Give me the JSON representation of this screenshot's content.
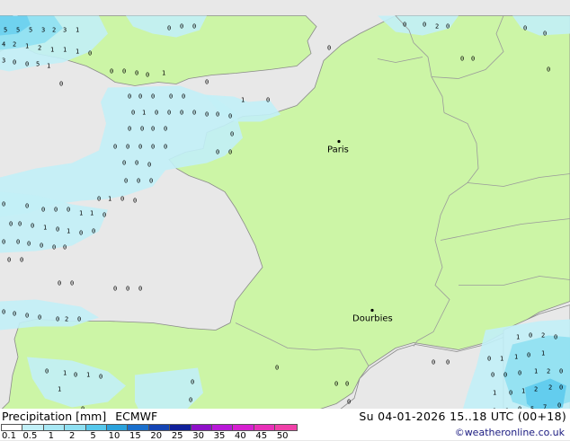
{
  "map": {
    "cities": [
      {
        "name": "Paris"
      },
      {
        "name": "Dourbies"
      }
    ],
    "colors": {
      "sea": "#e8e8e8",
      "land": "#ccf5a6",
      "border": "#9a9a9a",
      "coast": "#8a8a8a",
      "precip_light": "#c2f0f7",
      "precip_mid": "#8fe0f2",
      "precip_strong": "#56c8ec"
    }
  },
  "footer": {
    "title": "Precipitation [mm]",
    "model": "ECMWF",
    "datetime": "Su 04-01-2026 15..18 UTC (00+18)",
    "copyright": "©weatheronline.co.uk",
    "scale_labels": [
      "0.1",
      "0.5",
      "1",
      "2",
      "5",
      "10",
      "15",
      "20",
      "25",
      "30",
      "35",
      "40",
      "45",
      "50"
    ],
    "scale_colors": [
      "#ffffff",
      "#c2f0f7",
      "#a8e8f4",
      "#8fe0f2",
      "#56c8ec",
      "#2aa2dc",
      "#1a6fcc",
      "#1444b4",
      "#10209a",
      "#8e10c8",
      "#b818d8",
      "#d620d0",
      "#e830b8",
      "#f040a8"
    ]
  }
}
